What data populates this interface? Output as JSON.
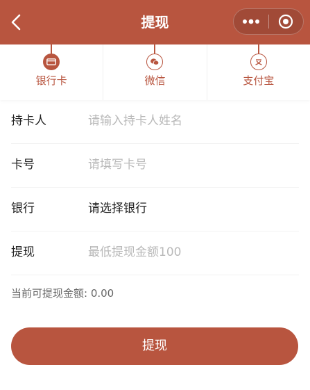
{
  "header": {
    "title": "提现",
    "back_icon": "chevron-left-icon",
    "more_icon": "more-dots-icon",
    "close_icon": "target-circle-icon"
  },
  "tabs": [
    {
      "label": "银行卡",
      "icon": "bank-card-icon",
      "active": true
    },
    {
      "label": "微信",
      "icon": "wechat-icon",
      "active": false
    },
    {
      "label": "支付宝",
      "icon": "alipay-icon",
      "active": false
    }
  ],
  "form": {
    "holder": {
      "label": "持卡人",
      "placeholder": "请输入持卡人姓名"
    },
    "card_no": {
      "label": "卡号",
      "placeholder": "请填写卡号"
    },
    "bank": {
      "label": "银行",
      "value": "请选择银行"
    },
    "amount": {
      "label": "提现",
      "placeholder": "最低提现金额100"
    }
  },
  "balance_text": "当前可提现金额: 0.00",
  "submit_label": "提现",
  "colors": {
    "accent": "#b8553f",
    "capsule": "#a14a37",
    "placeholder": "#b9b9b9"
  }
}
